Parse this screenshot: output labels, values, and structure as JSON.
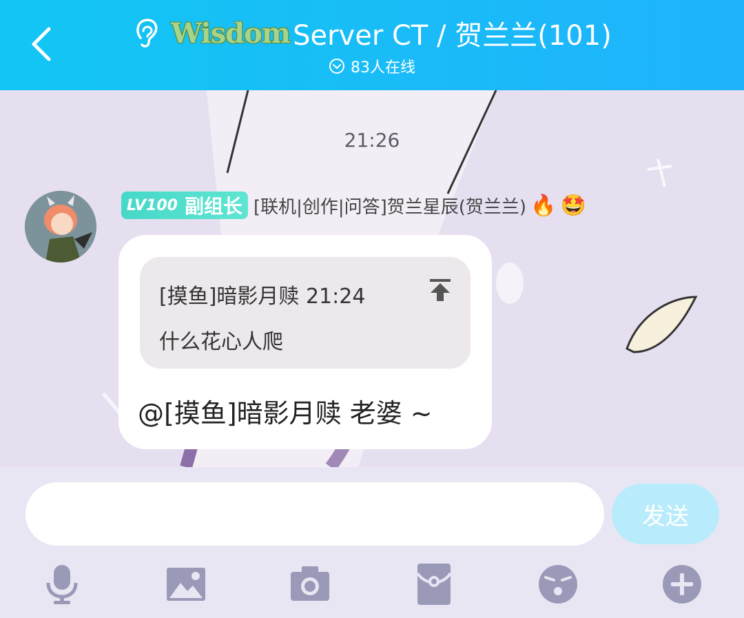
{
  "header": {
    "logo_text": "Wisdom",
    "title": "Server CT / 贺兰兰(101)",
    "online_count": "83人在线"
  },
  "chat": {
    "timestamp": "21:26",
    "sender": {
      "level": "LV100",
      "role": "副组长",
      "nickname": "[联机|创作|问答]贺兰星辰(贺兰兰)",
      "emojis": [
        "🔥",
        "🤩"
      ]
    },
    "message": {
      "quote_author": "[摸鱼]暗影月赎",
      "quote_time": "21:24",
      "quote_text": "什么花心人爬",
      "text": "@[摸鱼]暗影月赎 老婆 ~"
    }
  },
  "input": {
    "value": "",
    "placeholder": "",
    "send_label": "发送"
  },
  "toolbar": {
    "icons": [
      "microphone-icon",
      "image-icon",
      "camera-icon",
      "red-packet-icon",
      "emoji-icon",
      "plus-icon"
    ]
  },
  "colors": {
    "header": "#1fb3fb",
    "send_button": "#b8ebfb",
    "level_badge": "#46d8c8",
    "toolbar_icon": "#9a99b8"
  }
}
